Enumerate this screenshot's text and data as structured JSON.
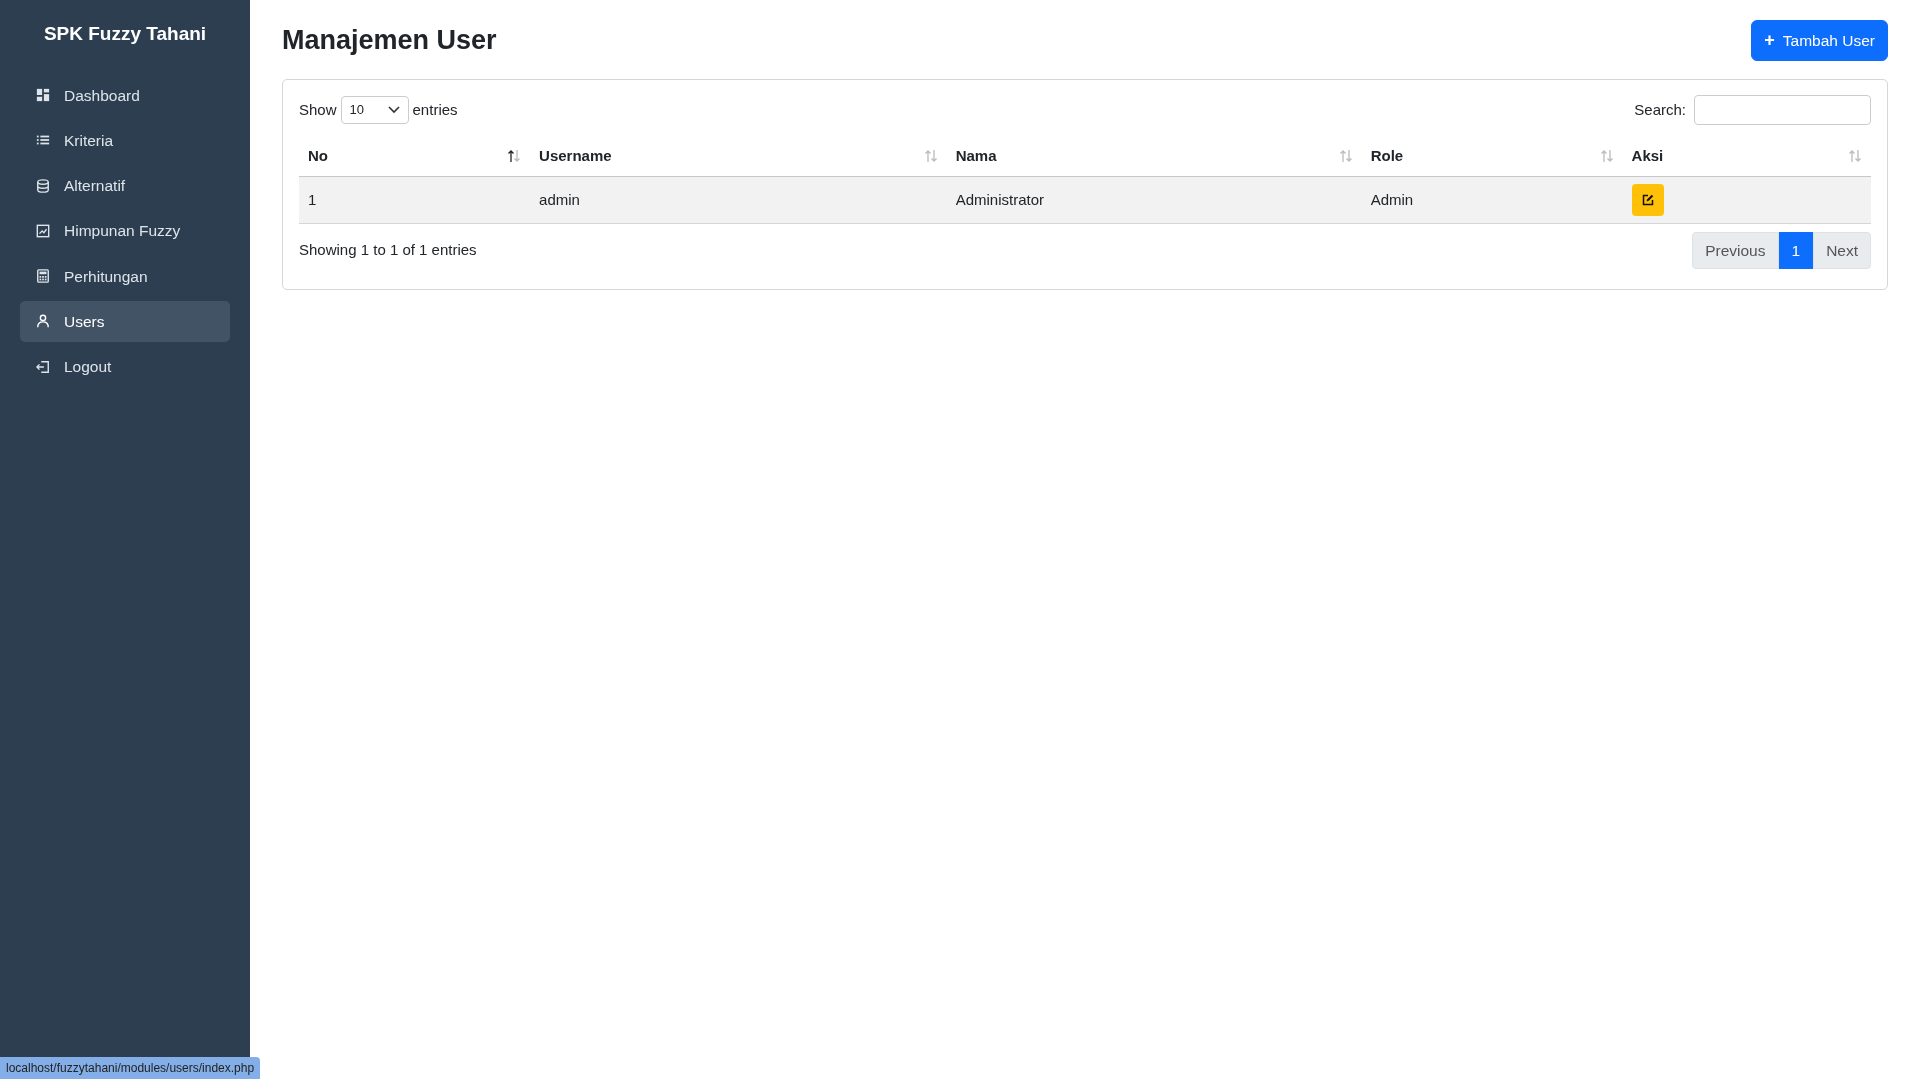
{
  "sidebar": {
    "brand": "SPK Fuzzy Tahani",
    "items": [
      {
        "label": "Dashboard",
        "selected": false
      },
      {
        "label": "Kriteria",
        "selected": false
      },
      {
        "label": "Alternatif",
        "selected": false
      },
      {
        "label": "Himpunan Fuzzy",
        "selected": false
      },
      {
        "label": "Perhitungan",
        "selected": false
      },
      {
        "label": "Users",
        "selected": true
      },
      {
        "label": "Logout",
        "selected": false
      }
    ]
  },
  "page_title": "Manajemen User",
  "add_button": {
    "icon": "+",
    "label": "Tambah User"
  },
  "table_controls": {
    "show_label": "Show",
    "page_size": "10",
    "entries_label": "entries",
    "search_label": "Search:"
  },
  "table": {
    "columns": [
      {
        "label": "No",
        "sorted": true
      },
      {
        "label": "Username",
        "sorted": false
      },
      {
        "label": "Nama",
        "sorted": false
      },
      {
        "label": "Role",
        "sorted": false
      },
      {
        "label": "Aksi",
        "sorted": false
      }
    ],
    "rows": [
      {
        "no": "1",
        "username": "admin",
        "nama": "Administrator",
        "role": "Admin"
      }
    ]
  },
  "info": "Showing 1 to 1 of 1 entries",
  "pagination": [
    {
      "label": "Previous",
      "selected": false
    },
    {
      "label": "1",
      "selected": true
    },
    {
      "label": "Next",
      "selected": false
    }
  ],
  "status_url": "localhost/fuzzytahani/modules/users/index.php"
}
